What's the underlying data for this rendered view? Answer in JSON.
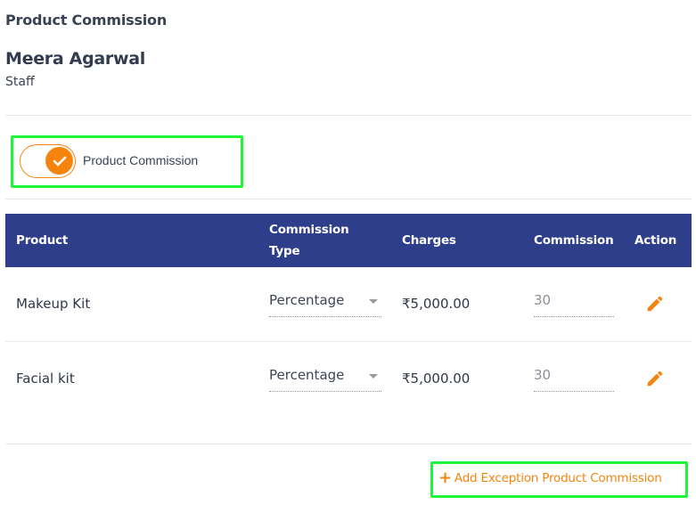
{
  "header": {
    "section_title": "Product Commission",
    "staff_name": "Meera Agarwal",
    "staff_role": "Staff"
  },
  "toggle": {
    "label": "Product Commission",
    "checked": true,
    "icon": "check-icon"
  },
  "table": {
    "columns": {
      "product": "Product",
      "commission_type": "Commission Type",
      "charges": "Charges",
      "commission": "Commission",
      "action": "Action"
    },
    "rows": [
      {
        "product": "Makeup Kit",
        "commission_type": "Percentage",
        "charges": "₹5,000.00",
        "commission": "30",
        "action_icon": "pencil-icon"
      },
      {
        "product": "Facial kit",
        "commission_type": "Percentage",
        "charges": "₹5,000.00",
        "commission": "30",
        "action_icon": "pencil-icon"
      }
    ]
  },
  "footer": {
    "add_exception_label": "Add Exception Product Commission",
    "add_icon": "plus-icon"
  },
  "colors": {
    "accent": "#f5840f",
    "table_header_bg": "#2e3e8b",
    "highlight": "#1cf53a"
  }
}
